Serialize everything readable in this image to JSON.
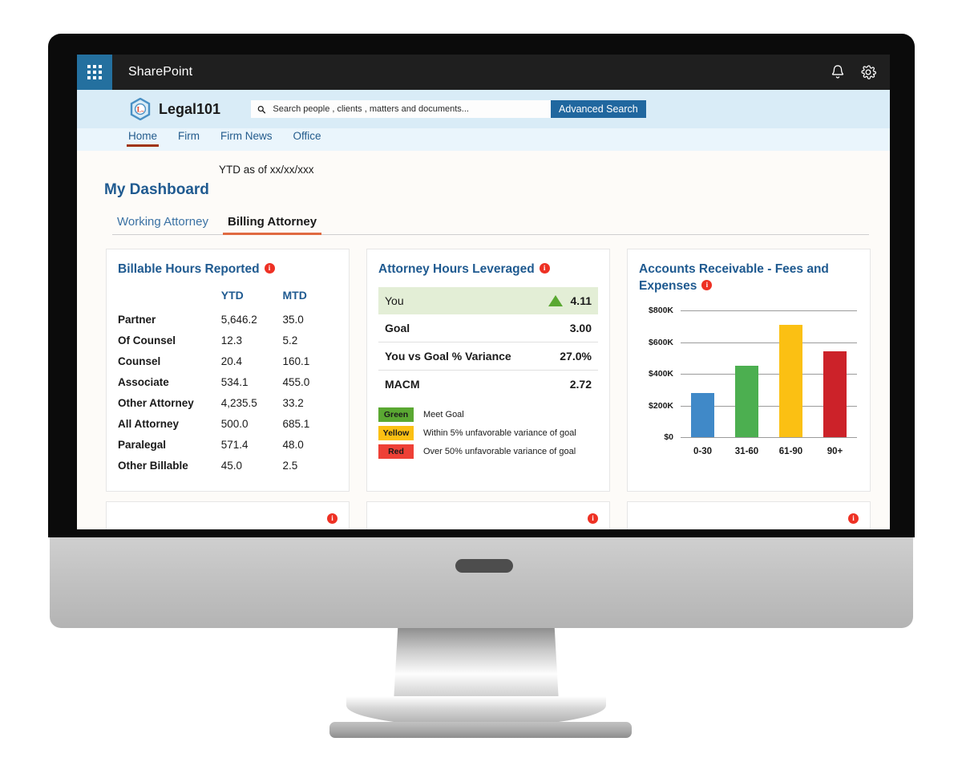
{
  "suite_bar": {
    "waffle_icon": "app-launcher-icon",
    "title": "SharePoint",
    "notifications_icon": "bell-icon",
    "settings_icon": "gear-icon"
  },
  "site_header": {
    "logo_icon": "hexagon-logo-icon",
    "logo_letter": "L.",
    "title": "Legal101",
    "search": {
      "icon": "search-icon",
      "placeholder": "Search people , clients , matters and documents...",
      "value": ""
    },
    "advanced_search_label": "Advanced Search"
  },
  "nav": {
    "items": [
      {
        "label": "Home",
        "active": true
      },
      {
        "label": "Firm",
        "active": false
      },
      {
        "label": "Firm News",
        "active": false
      },
      {
        "label": "Office",
        "active": false
      }
    ]
  },
  "dashboard": {
    "ytd_note": "YTD as of xx/xx/xxx",
    "title": "My Dashboard",
    "tabs": [
      {
        "label": "Working Attorney",
        "active": false
      },
      {
        "label": "Billing Attorney",
        "active": true
      }
    ]
  },
  "cards": {
    "billable_hours": {
      "title": "Billable Hours Reported",
      "info_icon": "info-icon",
      "columns": [
        "",
        "YTD",
        "MTD"
      ],
      "rows": [
        {
          "label": "Partner",
          "ytd": "5,646.2",
          "mtd": "35.0"
        },
        {
          "label": "Of Counsel",
          "ytd": "12.3",
          "mtd": "5.2"
        },
        {
          "label": "Counsel",
          "ytd": "20.4",
          "mtd": "160.1"
        },
        {
          "label": "Associate",
          "ytd": "534.1",
          "mtd": "455.0"
        },
        {
          "label": "Other Attorney",
          "ytd": "4,235.5",
          "mtd": "33.2"
        },
        {
          "label": "All Attorney",
          "ytd": "500.0",
          "mtd": "685.1"
        },
        {
          "label": "Paralegal",
          "ytd": "571.4",
          "mtd": "48.0"
        },
        {
          "label": "Other Billable",
          "ytd": "45.0",
          "mtd": "2.5"
        }
      ]
    },
    "hours_leveraged": {
      "title": "Attorney Hours Leveraged",
      "info_icon": "info-icon",
      "rows": [
        {
          "label": "You",
          "value": "4.11",
          "highlight": true,
          "trend_icon": "triangle-up-icon"
        },
        {
          "label": "Goal",
          "value": "3.00",
          "highlight": false
        },
        {
          "label": "You vs Goal % Variance",
          "value": "27.0%",
          "highlight": false
        },
        {
          "label": "MACM",
          "value": "2.72",
          "highlight": false
        }
      ],
      "legend": [
        {
          "chip": "Green",
          "color": "#5aa832",
          "text": "Meet Goal"
        },
        {
          "chip": "Yellow",
          "color": "#fbc013",
          "text": "Within 5% unfavorable variance of goal"
        },
        {
          "chip": "Red",
          "color": "#ee4036",
          "text": "Over 50% unfavorable variance of goal"
        }
      ]
    },
    "accounts_receivable": {
      "title": "Accounts Receivable - Fees and Expenses",
      "info_icon": "info-icon"
    }
  },
  "chart_data": {
    "type": "bar",
    "title": "Accounts Receivable - Fees and Expenses",
    "xlabel": "",
    "ylabel": "",
    "categories": [
      "0-30",
      "31-60",
      "61-90",
      "90+"
    ],
    "values": [
      280000,
      450000,
      710000,
      545000
    ],
    "colors": [
      "#4089c8",
      "#4caf50",
      "#fbc013",
      "#cc2229"
    ],
    "ylim": [
      0,
      800000
    ],
    "yticks": [
      0,
      200000,
      400000,
      600000,
      800000
    ],
    "ytick_labels": [
      "$0",
      "$200K",
      "$400K",
      "$600K",
      "$800K"
    ],
    "grid": true,
    "legend": "none"
  },
  "theme": {
    "suite_bar_bg": "#1f1f1f",
    "waffle_bg": "#24709f",
    "site_header_bg": "#d9ecf7",
    "nav_bg": "#eaf5fc",
    "accent_blue": "#1f5a90",
    "accent_orange": "#e06a41",
    "nav_active_underline": "#a0340f",
    "info_red": "#ee3124",
    "highlight_green_bg": "#e3eed6"
  },
  "bottom_cards": [
    {
      "info_icon": "info-icon"
    },
    {
      "info_icon": "info-icon"
    },
    {
      "info_icon": "info-icon"
    }
  ]
}
